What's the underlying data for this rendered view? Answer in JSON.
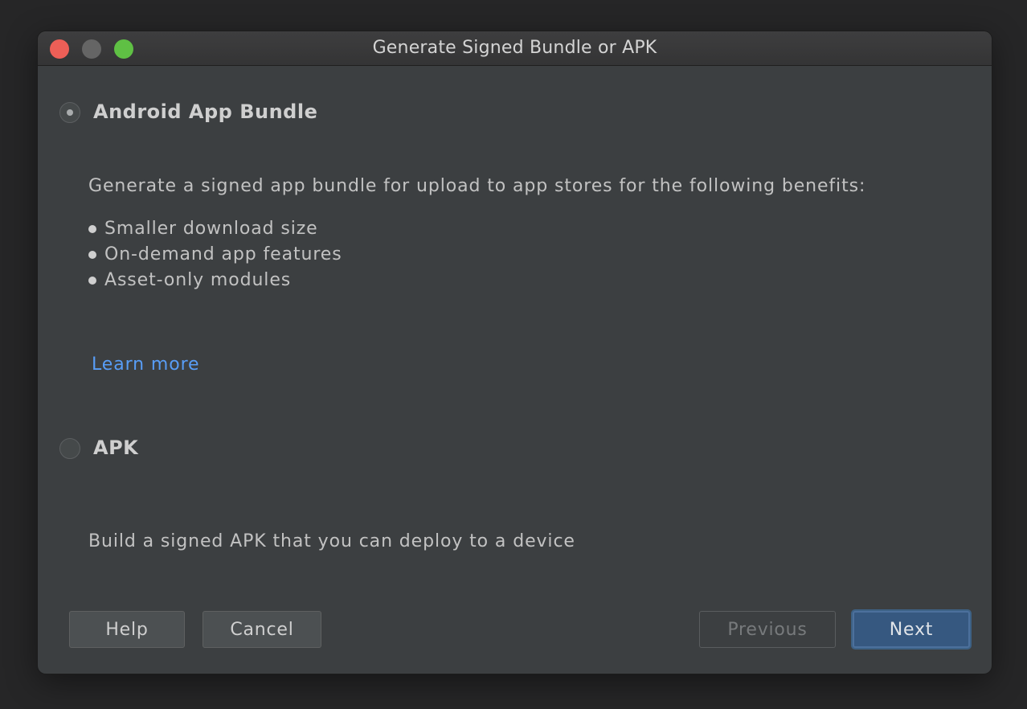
{
  "window": {
    "title": "Generate Signed Bundle or APK"
  },
  "options": {
    "bundle": {
      "label": "Android App Bundle",
      "selected": true,
      "description": "Generate a signed app bundle for upload to app stores for the following benefits:",
      "benefits": [
        "Smaller download size",
        "On-demand app features",
        "Asset-only modules"
      ],
      "learn_more": "Learn more"
    },
    "apk": {
      "label": "APK",
      "selected": false,
      "description": "Build a signed APK that you can deploy to a device"
    }
  },
  "buttons": {
    "help": "Help",
    "cancel": "Cancel",
    "previous": "Previous",
    "next": "Next"
  },
  "colors": {
    "background": "#3c3f41",
    "link": "#589df6",
    "primary_button": "#365880",
    "close": "#ed5f57",
    "minimize": "#656565",
    "maximize": "#5fc044"
  }
}
